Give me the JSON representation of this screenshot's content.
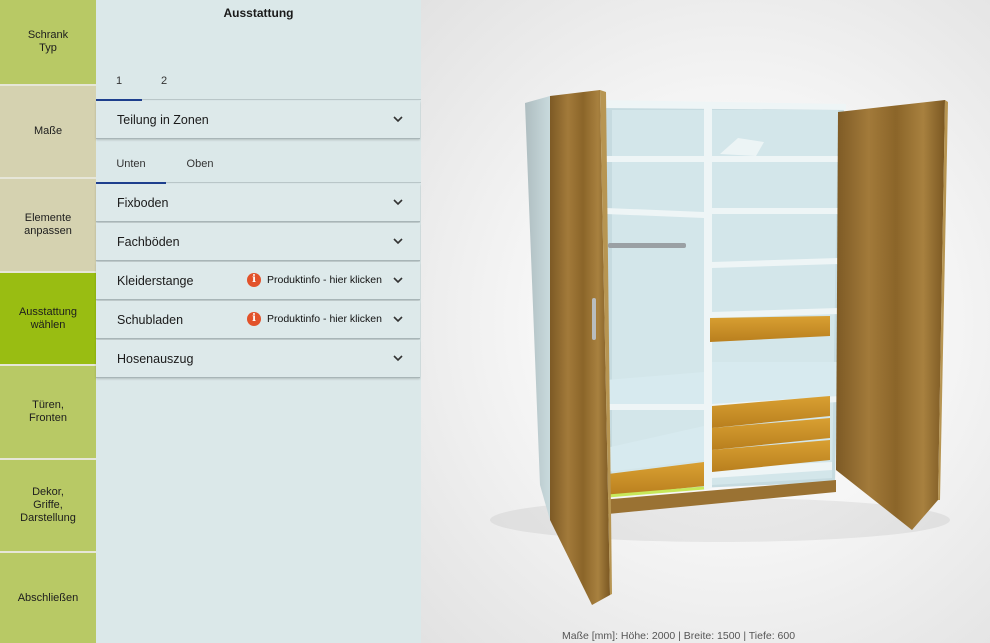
{
  "steps": [
    {
      "label": "Schrank\nTyp",
      "bg": "#b8c965"
    },
    {
      "label": "Maße",
      "bg": "#d5d2b0"
    },
    {
      "label": "Elemente\nanpassen",
      "bg": "#d5d2b0"
    },
    {
      "label": "Ausstattung\nwählen",
      "bg": "#99bd12",
      "active": true
    },
    {
      "label": "Türen,\nFronten",
      "bg": "#b8c965"
    },
    {
      "label": "Dekor,\nGriffe,\nDarstellung",
      "bg": "#b8c965"
    },
    {
      "label": "Abschließen",
      "bg": "#b8c965"
    }
  ],
  "panel": {
    "title": "Ausstattung",
    "zone_tabs": [
      "1",
      "2"
    ],
    "zone_tabs_active": "1",
    "zones_accordion": "Teilung in Zonen",
    "section_tabs": [
      "Unten",
      "Oben"
    ],
    "section_tabs_active": "Unten",
    "items": [
      {
        "label": "Fixboden"
      },
      {
        "label": "Fachböden"
      },
      {
        "label": "Kleiderstange",
        "info": "Produktinfo - hier klicken"
      },
      {
        "label": "Schubladen",
        "info": "Produktinfo - hier klicken"
      },
      {
        "label": "Hosenauszug"
      }
    ]
  },
  "view": {
    "measurements": "Maße [mm]:  Höhe: 2000 |  Breite: 1500 |  Tiefe: 600"
  },
  "colors": {
    "accent": "#1e3f8f",
    "info": "#e2522a",
    "wood": "#9a7233",
    "carcass": "#d3e6ea"
  }
}
